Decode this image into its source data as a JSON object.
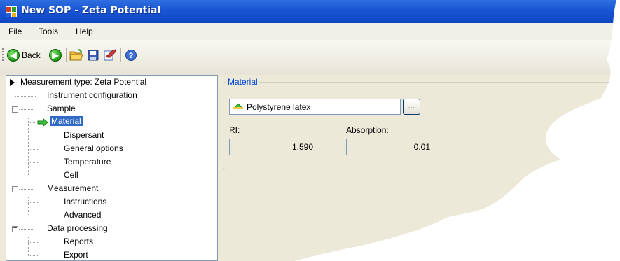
{
  "window": {
    "title": "New SOP - Zeta Potential"
  },
  "menu": [
    "File",
    "Tools",
    "Help"
  ],
  "toolbar": {
    "back_label": "Back",
    "icons": [
      "back-arrow-icon",
      "forward-arrow-icon",
      "open-folder-icon",
      "save-icon",
      "edit-sign-icon",
      "help-icon"
    ]
  },
  "tree": {
    "root_label": "Measurement type: Zeta Potential",
    "items": [
      {
        "label": "Instrument configuration",
        "level": 1
      },
      {
        "label": "Sample",
        "level": 1,
        "expanded": true
      },
      {
        "label": "Material",
        "level": 2,
        "selected": true
      },
      {
        "label": "Dispersant",
        "level": 2
      },
      {
        "label": "General options",
        "level": 2
      },
      {
        "label": "Temperature",
        "level": 2
      },
      {
        "label": "Cell",
        "level": 2
      },
      {
        "label": "Measurement",
        "level": 1,
        "expanded": true
      },
      {
        "label": "Instructions",
        "level": 2
      },
      {
        "label": "Advanced",
        "level": 2
      },
      {
        "label": "Data processing",
        "level": 1,
        "expanded": true
      },
      {
        "label": "Reports",
        "level": 2
      },
      {
        "label": "Export",
        "level": 2
      }
    ]
  },
  "material_panel": {
    "group_title": "Material",
    "material_value": "Polystyrene latex",
    "browse_label": "...",
    "ri_label": "RI:",
    "ri_value": "1.590",
    "absorption_label": "Absorption:",
    "absorption_value": "0.01"
  },
  "colors": {
    "titlebar": "#1a55d4",
    "selection": "#316ac5",
    "group_title": "#0046d5"
  }
}
